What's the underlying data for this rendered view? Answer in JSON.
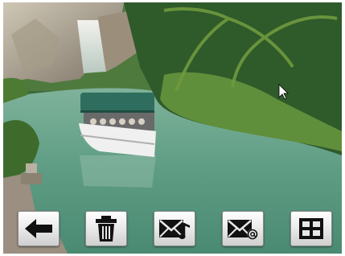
{
  "screen": {
    "background_scene": "lagoon-boat-photo"
  },
  "toolbar": {
    "buttons": [
      {
        "id": "back",
        "icon": "back-arrow-icon"
      },
      {
        "id": "delete",
        "icon": "trash-icon"
      },
      {
        "id": "send-to-music",
        "icon": "envelope-music-icon"
      },
      {
        "id": "send-email",
        "icon": "envelope-at-icon"
      },
      {
        "id": "thumbnail-grid",
        "icon": "grid-icon"
      }
    ]
  },
  "colors": {
    "button_top": "#ffffff",
    "button_bottom": "#cfcfcf",
    "icon": "#111111",
    "water": "#5e9c84"
  }
}
